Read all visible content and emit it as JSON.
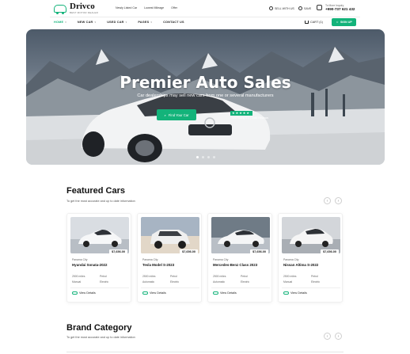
{
  "header": {
    "logo_name": "Drivco",
    "logo_tagline": "BEST MOTOR DEALER",
    "top_links": [
      "Newly Listed Car",
      "Lowest Mileage",
      "Offer"
    ],
    "sell_label": "SELL WITH US",
    "save_label": "SAVE",
    "phone_label": "To More Inquiry",
    "phone_number": "+990-737 621 432"
  },
  "nav": {
    "items": [
      "HOME",
      "NEW CAR",
      "USED CAR",
      "PAGES",
      "CONTACT US"
    ],
    "cart_label": "CART (1)",
    "signup_label": "SIGN UP"
  },
  "hero": {
    "title": "Premier Auto Sales",
    "subtitle": "Car dealerships may sell new cars from one or several manufacturers",
    "button_label": "Find Your Car",
    "rating_label": "Trust Rating 5.0 | 2348 Reviews"
  },
  "featured": {
    "title": "Featured Cars",
    "subtitle": "To get the most accurate and up to date information",
    "cards": [
      {
        "price": "$7,656.00",
        "location": "Panama City",
        "model": "Hyundai Sonata-2022",
        "specs": [
          "2500 miles",
          "Petrol",
          "Manual",
          "Electric"
        ],
        "view": "View Details"
      },
      {
        "price": "$7,656.00",
        "location": "Panama City",
        "model": "Tesla Model S-2023",
        "specs": [
          "2500 miles",
          "Petrol",
          "Automatic",
          "Electric"
        ],
        "view": "View Details"
      },
      {
        "price": "$7,656.00",
        "location": "Panama City",
        "model": "Mercedes-Benz Class 2023",
        "specs": [
          "2500 miles",
          "Petrol",
          "Automatic",
          "Electric"
        ],
        "view": "View Details"
      },
      {
        "price": "$7,656.00",
        "location": "Panama City",
        "model": "Nissan Altima S-2022",
        "specs": [
          "2500 miles",
          "Petrol",
          "Manual",
          "Electric"
        ],
        "view": "View Details"
      }
    ]
  },
  "brand": {
    "title": "Brand Category",
    "subtitle": "To get the most accurate and up to date information"
  },
  "colors": {
    "accent": "#13b37a",
    "text": "#111111"
  }
}
